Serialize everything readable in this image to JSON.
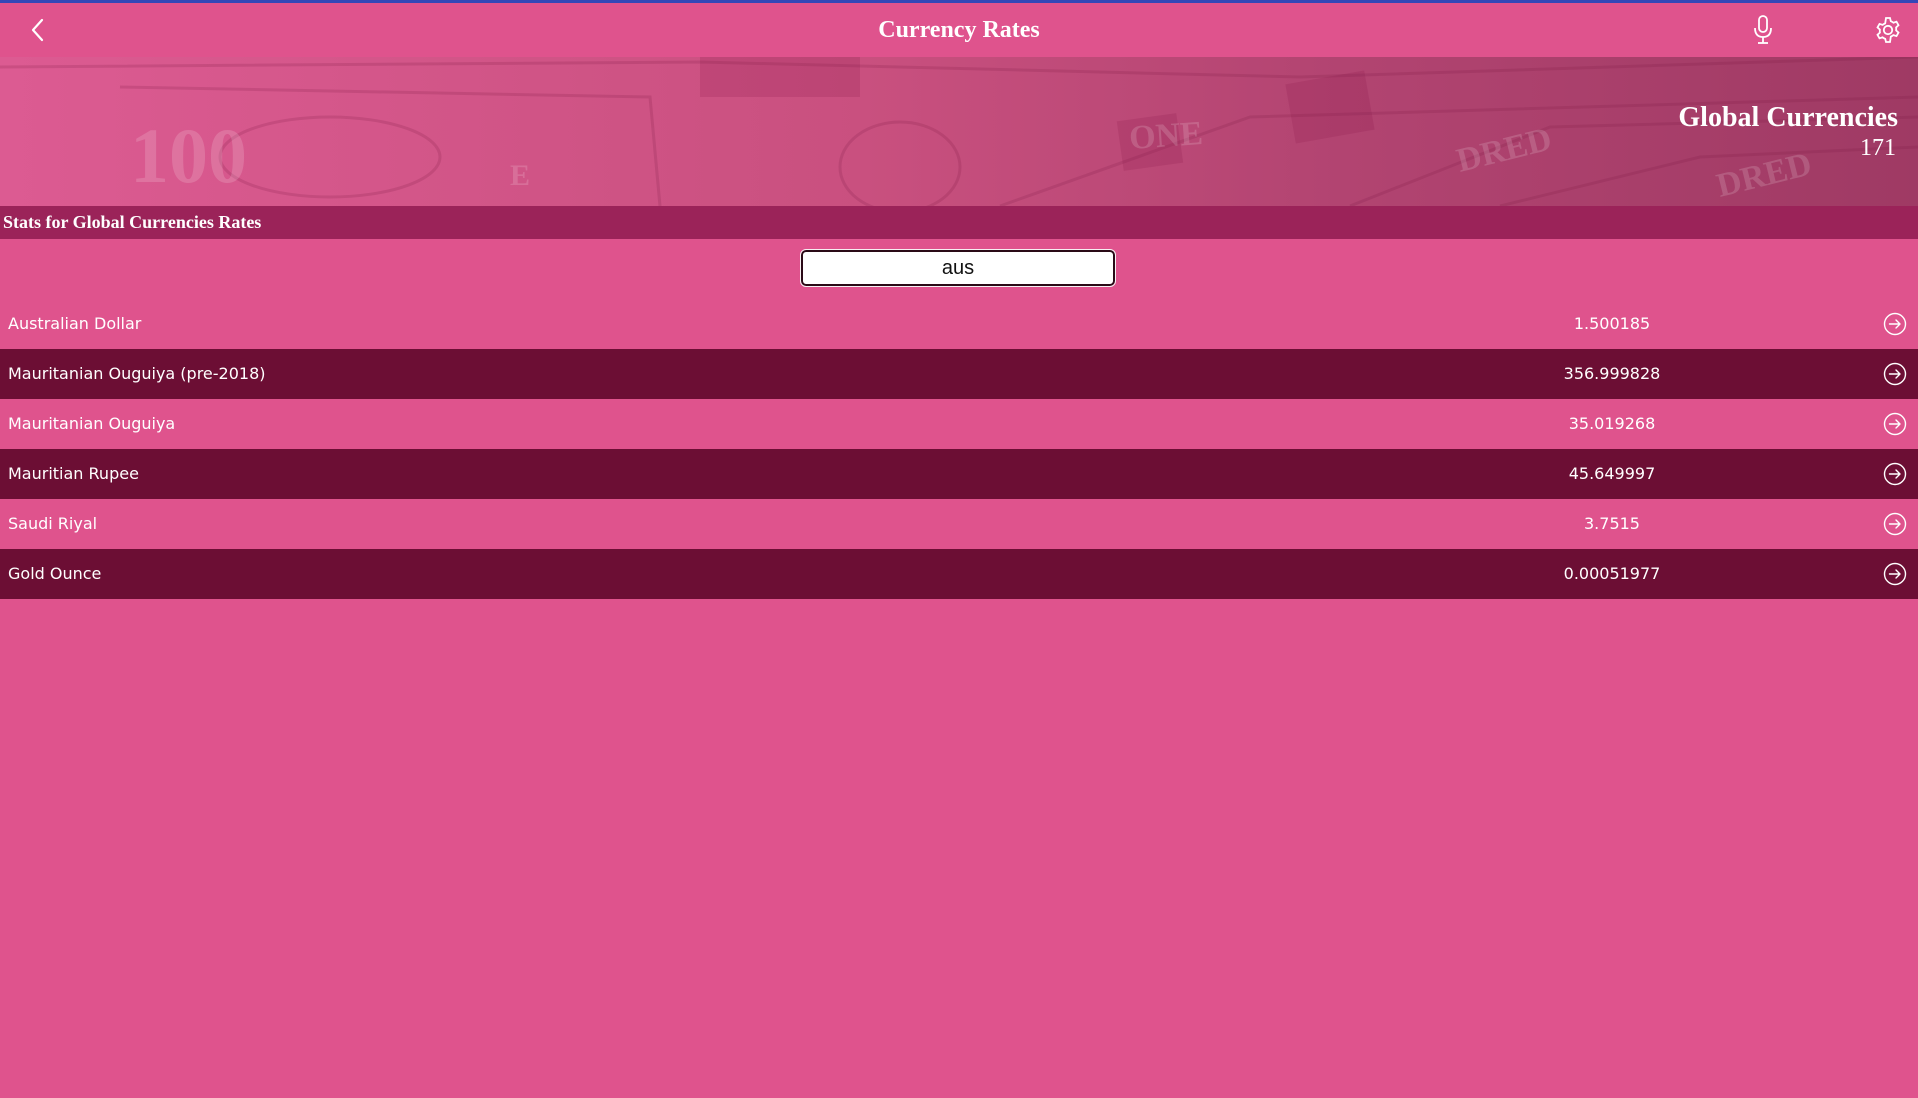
{
  "header": {
    "title": "Currency Rates",
    "back_icon": "chevron-left-icon",
    "mic_icon": "microphone-icon",
    "settings_icon": "gear-icon"
  },
  "banner": {
    "title": "Global Currencies",
    "count": "171"
  },
  "stats_bar": {
    "label": "Stats for Global Currencies Rates"
  },
  "search": {
    "value": "aus"
  },
  "rows": [
    {
      "name": "Australian Dollar",
      "value": "1.500185"
    },
    {
      "name": "Mauritanian Ouguiya (pre-2018)",
      "value": "356.999828"
    },
    {
      "name": "Mauritanian Ouguiya",
      "value": "35.019268"
    },
    {
      "name": "Mauritian Rupee",
      "value": "45.649997"
    },
    {
      "name": "Saudi Riyal",
      "value": "3.7515"
    },
    {
      "name": "Gold Ounce",
      "value": "0.00051977"
    }
  ],
  "colors": {
    "background": "#df538d",
    "row_dark": "#6c0e34",
    "stats_bar": "#9b2359",
    "top_accent": "#3347b8"
  }
}
